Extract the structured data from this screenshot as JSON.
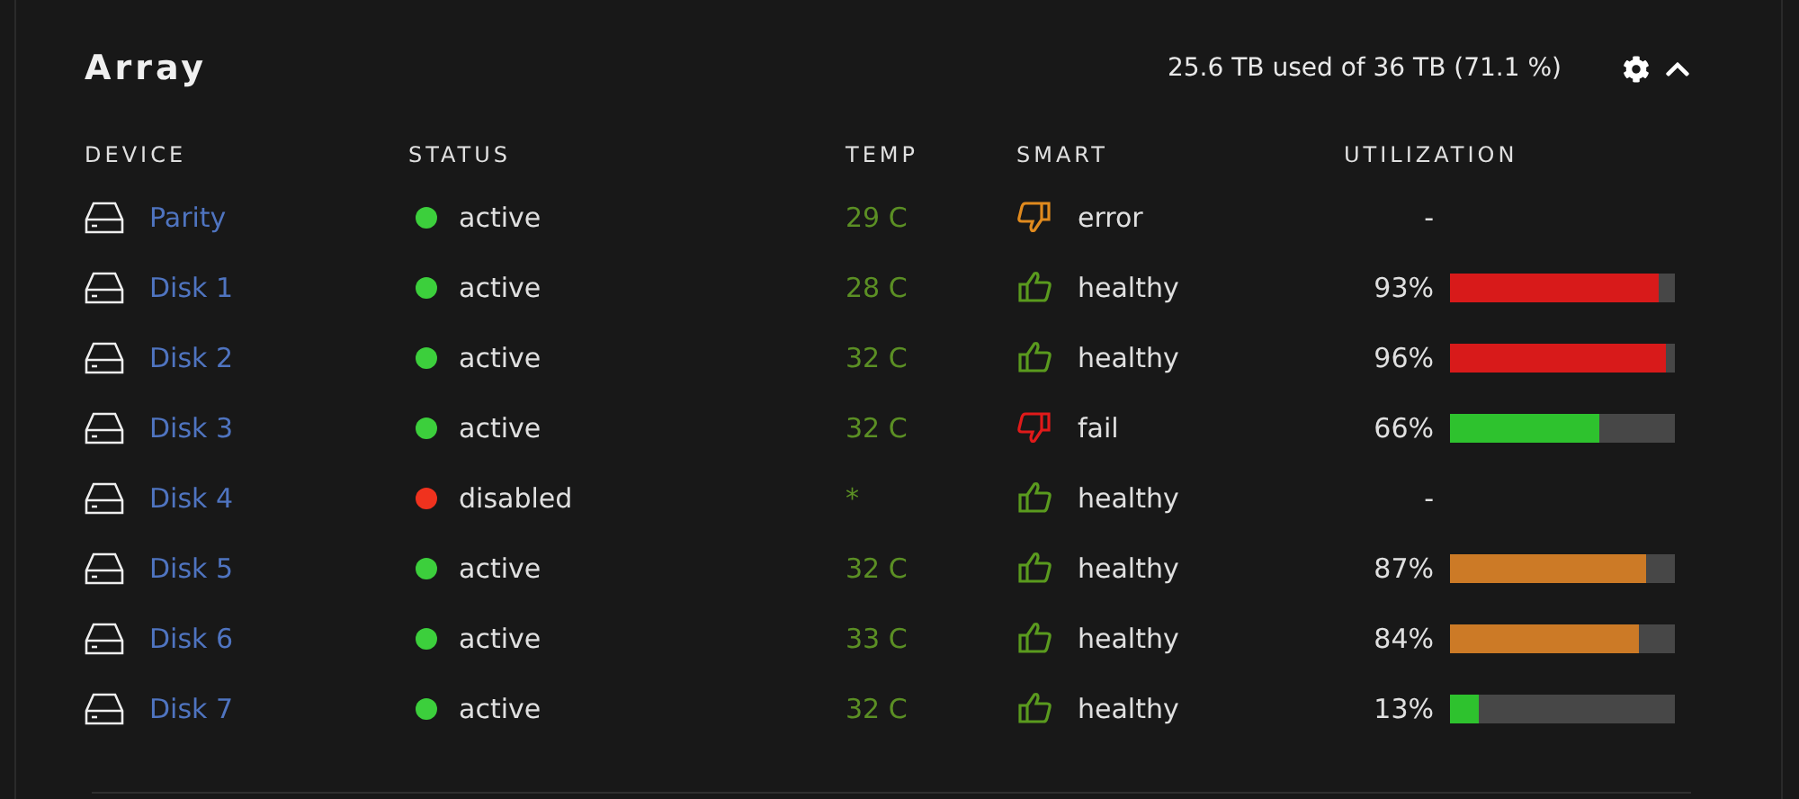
{
  "panel": {
    "title": "Array",
    "usage": "25.6 TB used of 36 TB (71.1 %)",
    "expanded": true
  },
  "table": {
    "columns": [
      "DEVICE",
      "STATUS",
      "TEMP",
      "SMART",
      "UTILIZATION"
    ],
    "rows": [
      {
        "device": "Parity",
        "status": {
          "text": "active",
          "color": "#3ccf3c"
        },
        "temp": "29 C",
        "smart": {
          "text": "error",
          "kind": "thumbs-down",
          "color": "#e08a1e"
        },
        "utilization": {
          "reading": "-"
        }
      },
      {
        "device": "Disk 1",
        "status": {
          "text": "active",
          "color": "#3ccf3c"
        },
        "temp": "28 C",
        "smart": {
          "text": "healthy",
          "kind": "thumbs-up",
          "color": "#5a9a1e"
        },
        "utilization": {
          "reading": "93%",
          "level": 0.93,
          "color": "#d81a1a"
        }
      },
      {
        "device": "Disk 2",
        "status": {
          "text": "active",
          "color": "#3ccf3c"
        },
        "temp": "32 C",
        "smart": {
          "text": "healthy",
          "kind": "thumbs-up",
          "color": "#5a9a1e"
        },
        "utilization": {
          "reading": "96%",
          "level": 0.96,
          "color": "#d81a1a"
        }
      },
      {
        "device": "Disk 3",
        "status": {
          "text": "active",
          "color": "#3ccf3c"
        },
        "temp": "32 C",
        "smart": {
          "text": "fail",
          "kind": "thumbs-down",
          "color": "#e01a1a"
        },
        "utilization": {
          "reading": "66%",
          "level": 0.66,
          "color": "#2ec22e"
        }
      },
      {
        "device": "Disk 4",
        "status": {
          "text": "disabled",
          "color": "#f0321e"
        },
        "temp": "*",
        "smart": {
          "text": "healthy",
          "kind": "thumbs-up",
          "color": "#5a9a1e"
        },
        "utilization": {
          "reading": "-"
        }
      },
      {
        "device": "Disk 5",
        "status": {
          "text": "active",
          "color": "#3ccf3c"
        },
        "temp": "32 C",
        "smart": {
          "text": "healthy",
          "kind": "thumbs-up",
          "color": "#5a9a1e"
        },
        "utilization": {
          "reading": "87%",
          "level": 0.87,
          "color": "#cc7a26"
        }
      },
      {
        "device": "Disk 6",
        "status": {
          "text": "active",
          "color": "#3ccf3c"
        },
        "temp": "33 C",
        "smart": {
          "text": "healthy",
          "kind": "thumbs-up",
          "color": "#5a9a1e"
        },
        "utilization": {
          "reading": "84%",
          "level": 0.84,
          "color": "#cc7a26"
        }
      },
      {
        "device": "Disk 7",
        "status": {
          "text": "active",
          "color": "#3ccf3c"
        },
        "temp": "32 C",
        "smart": {
          "text": "healthy",
          "kind": "thumbs-up",
          "color": "#5a9a1e"
        },
        "utilization": {
          "reading": "13%",
          "level": 0.13,
          "color": "#2ec22e"
        }
      }
    ]
  }
}
